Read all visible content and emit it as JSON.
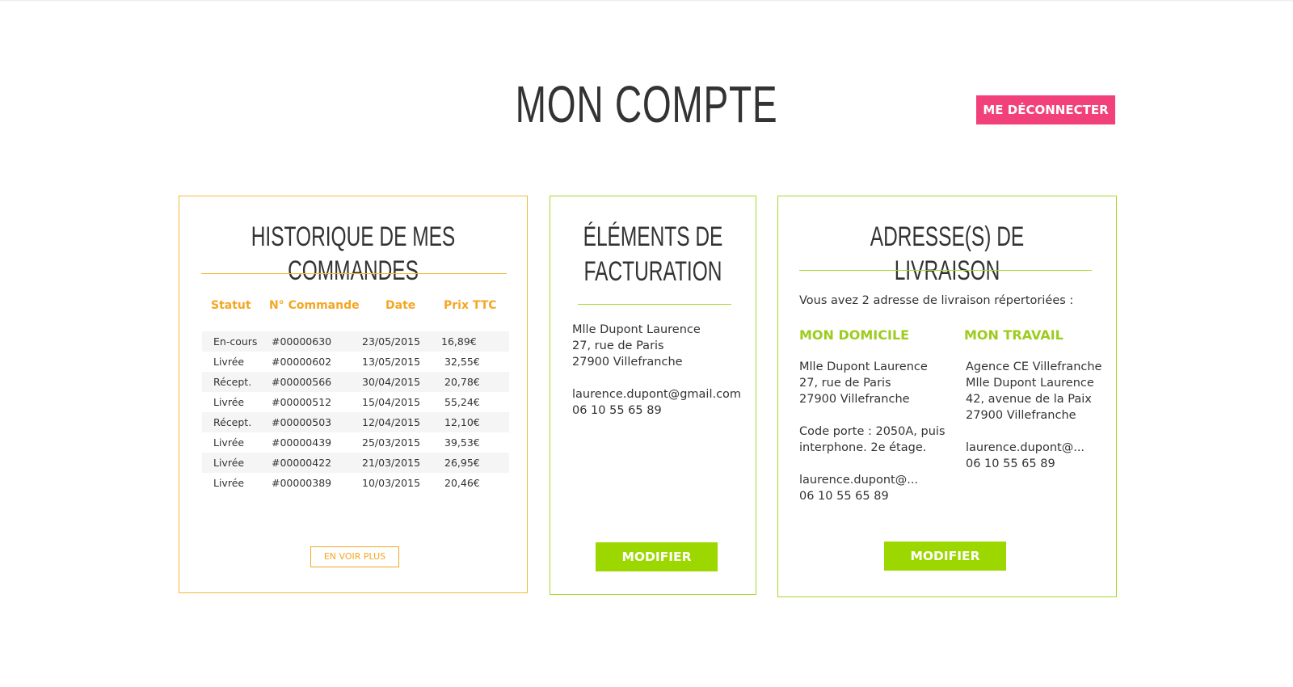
{
  "page": {
    "title": "MON COMPTE",
    "logout_label": "ME DÉCONNECTER"
  },
  "orders": {
    "title": "HISTORIQUE DE MES COMMANDES",
    "headers": {
      "status": "Statut",
      "number": "N° Commande",
      "date": "Date",
      "price": "Prix TTC"
    },
    "rows": [
      {
        "status": "En-cours",
        "number": "#00000630",
        "date": "23/05/2015",
        "price": "16,89€"
      },
      {
        "status": "Livrée",
        "number": "#00000602",
        "date": "13/05/2015",
        "price": "32,55€"
      },
      {
        "status": "Récept.",
        "number": "#00000566",
        "date": "30/04/2015",
        "price": "20,78€"
      },
      {
        "status": "Livrée",
        "number": "#00000512",
        "date": "15/04/2015",
        "price": "55,24€"
      },
      {
        "status": "Récept.",
        "number": "#00000503",
        "date": "12/04/2015",
        "price": "12,10€"
      },
      {
        "status": "Livrée",
        "number": "#00000439",
        "date": "25/03/2015",
        "price": "39,53€"
      },
      {
        "status": "Livrée",
        "number": "#00000422",
        "date": "21/03/2015",
        "price": "26,95€"
      },
      {
        "status": "Livrée",
        "number": "#00000389",
        "date": "10/03/2015",
        "price": "20,46€"
      }
    ],
    "more_label": "EN VOIR PLUS"
  },
  "billing": {
    "title_line1": "ÉLÉMENTS DE",
    "title_line2": "FACTURATION",
    "name": "Mlle Dupont Laurence",
    "street": "27, rue de Paris",
    "city": "27900 Villefranche",
    "email": "laurence.dupont@gmail.com",
    "phone": "06 10 55 65 89",
    "modify_label": "MODIFIER"
  },
  "delivery": {
    "title": "ADRESSE(S) DE LIVRAISON",
    "intro": "Vous avez 2 adresse de livraison répertoriées :",
    "home": {
      "label": "MON DOMICILE",
      "name": "Mlle Dupont Laurence",
      "street": "27, rue de Paris",
      "city": "27900 Villefranche",
      "note_line1": "Code porte : 2050A, puis",
      "note_line2": "interphone. 2e étage.",
      "email": "laurence.dupont@...",
      "phone": "06 10 55 65 89"
    },
    "work": {
      "label": "MON TRAVAIL",
      "company": "Agence CE Villefranche",
      "name": "Mlle Dupont Laurence",
      "street": "42, avenue de la Paix",
      "city": "27900 Villefranche",
      "email": "laurence.dupont@...",
      "phone": "06 10 55 65 89"
    },
    "modify_label": "MODIFIER"
  },
  "colors": {
    "accent_pink": "#f2407a",
    "accent_orange": "#f5a623",
    "accent_green": "#9cd800"
  }
}
